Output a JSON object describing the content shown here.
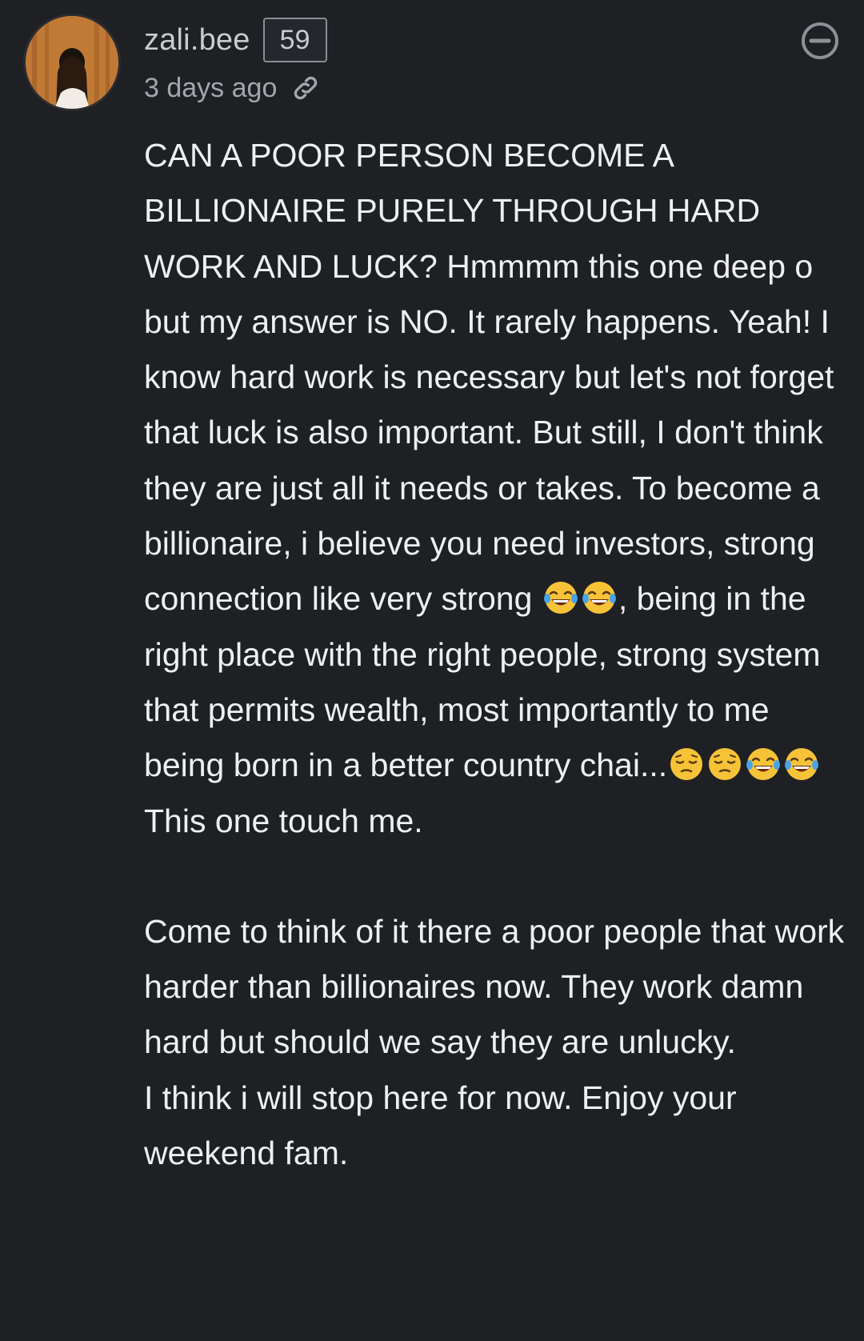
{
  "comment": {
    "user": {
      "username": "zali.bee",
      "badge_count": "59"
    },
    "timestamp": "3 days ago",
    "icons": {
      "link": "link-icon",
      "collapse": "collapse-minus-icon",
      "emoji_laugh": "face-with-tears-of-joy",
      "emoji_pensive": "pensive-face"
    },
    "paragraph_1": {
      "part_1": "CAN A POOR PERSON BECOME A BILLIONAIRE PURELY THROUGH HARD WORK AND LUCK? Hmmmm this one deep o but my answer is NO. It rarely happens. Yeah! I know hard work is necessary but let's not forget that luck is also important. But still, I don't think they are just all it needs or takes. To become a billionaire, i believe you need investors, strong connection like very strong ",
      "part_2": ", being in the right place with the right people, strong system that permits wealth, most importantly to me being born in a better country chai...",
      "part_3": " This one touch me."
    },
    "paragraph_2": "Come to think of it there a poor people that work harder than billionaires now. They work damn hard but should we say they are unlucky.",
    "paragraph_3": "I think i will stop here for now. Enjoy your weekend fam."
  },
  "colors": {
    "background": "#1e2024",
    "text": "#eeeff1",
    "muted": "#a3a6ac"
  }
}
